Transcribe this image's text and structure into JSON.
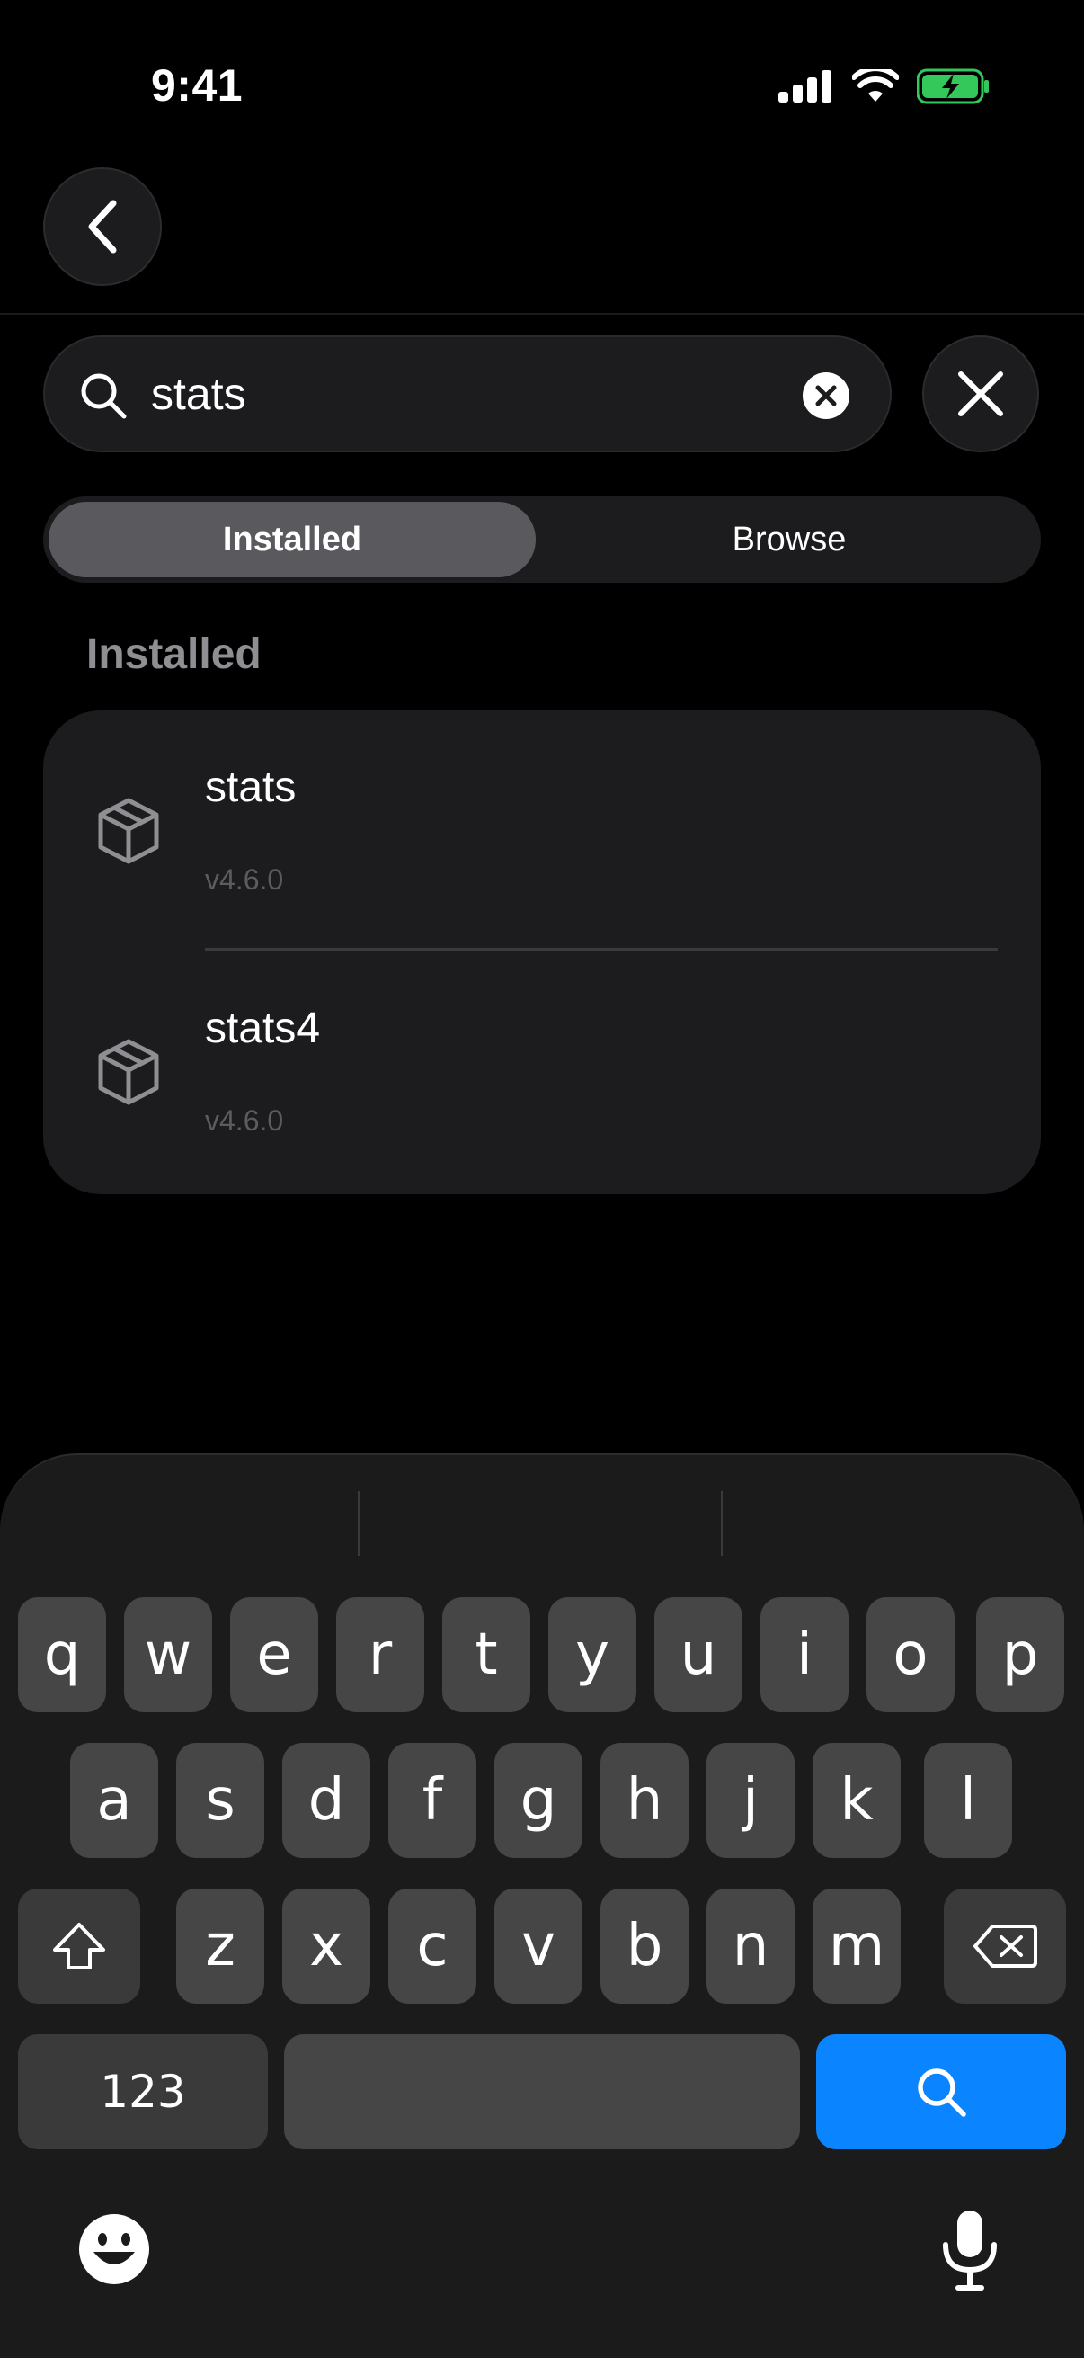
{
  "status_bar": {
    "time": "9:41"
  },
  "search": {
    "query": "stats"
  },
  "segments": {
    "selected": "Installed",
    "other": "Browse"
  },
  "section_title": "Installed",
  "packages": [
    {
      "name": "stats",
      "version": "v4.6.0"
    },
    {
      "name": "stats4",
      "version": "v4.6.0"
    }
  ],
  "keyboard": {
    "row1": [
      "q",
      "w",
      "e",
      "r",
      "t",
      "y",
      "u",
      "i",
      "o",
      "p"
    ],
    "row2": [
      "a",
      "s",
      "d",
      "f",
      "g",
      "h",
      "j",
      "k",
      "l"
    ],
    "row3": [
      "z",
      "x",
      "c",
      "v",
      "b",
      "n",
      "m"
    ],
    "numbers_key": "123",
    "accent_color": "#0a84ff"
  }
}
